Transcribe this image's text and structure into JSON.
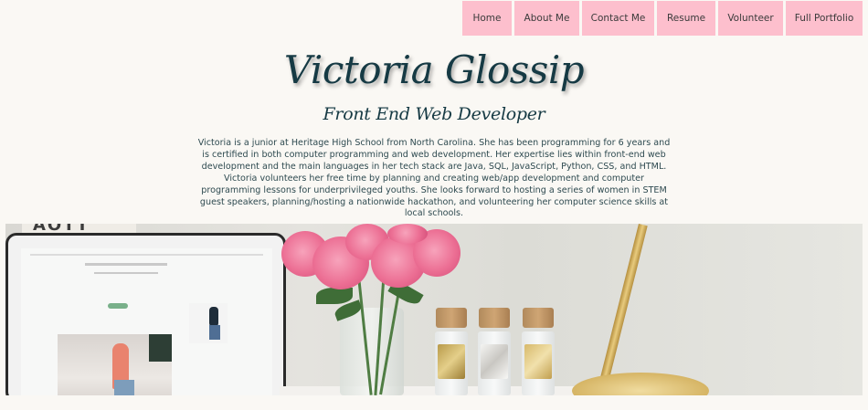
{
  "nav": {
    "items": [
      {
        "label": "Home"
      },
      {
        "label": "About Me"
      },
      {
        "label": "Contact Me"
      },
      {
        "label": "Resume"
      },
      {
        "label": "Volunteer"
      },
      {
        "label": "Full Portfolio"
      }
    ]
  },
  "header": {
    "title": "Victoria Glossip",
    "subtitle": "Front End Web Developer",
    "bio": "Victoria is a junior at Heritage High School from North Carolina. She has been programming for 6 years and is certified in both computer programming and web development. Her expertise lies within front-end web development and the main languages in her tech stack are Java, SQL, JavaScript, Python, CSS, and HTML. Victoria volunteers her free time by planning and creating web/app development and computer programming lessons for underprivileged youths. She looks forward to hosting a series of women in STEM guest speakers, planning/hosting a nationwide hackathon, and volunteering her computer science skills at local schools."
  },
  "hero": {
    "sign_text": "AOTT"
  },
  "colors": {
    "nav_bg": "#fdbfcd",
    "page_bg": "#faf8f4",
    "title_color": "#163a44"
  }
}
